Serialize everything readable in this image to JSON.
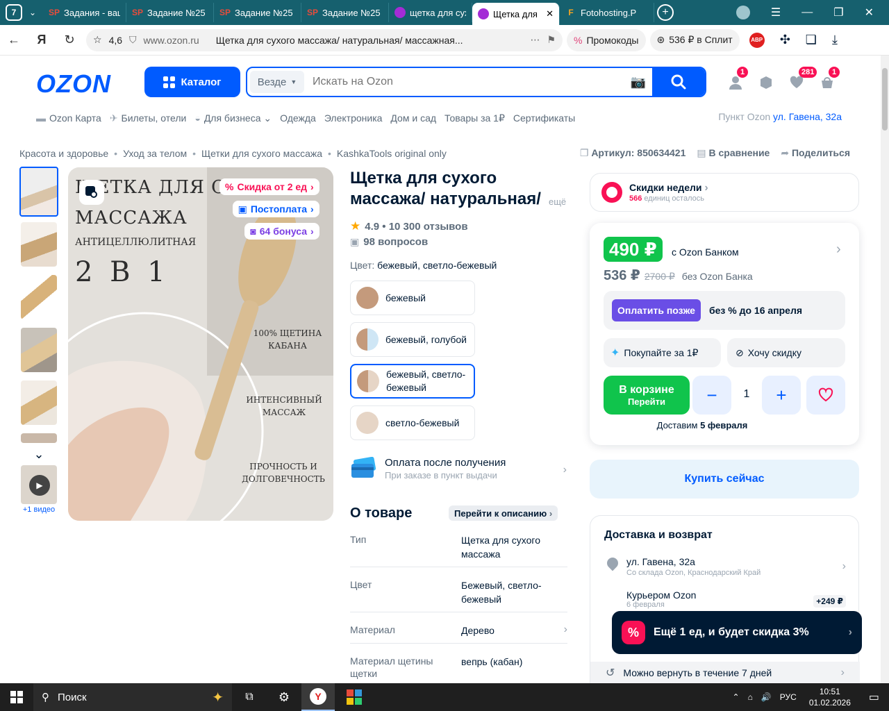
{
  "browser": {
    "tab_count": "7",
    "tabs": [
      {
        "label": "Задания - ваш",
        "icon": "SP",
        "color": "#e74c3c"
      },
      {
        "label": "Задание №25",
        "icon": "SP",
        "color": "#e74c3c"
      },
      {
        "label": "Задание №25",
        "icon": "SP",
        "color": "#e74c3c"
      },
      {
        "label": "Задание №25",
        "icon": "SP",
        "color": "#e74c3c"
      },
      {
        "label": "щетка для сух",
        "icon": "ozon",
        "color": "#a42cd6"
      },
      {
        "label": "Щетка для",
        "icon": "ozon",
        "color": "#a42cd6"
      },
      {
        "label": "Fotohosting.P",
        "icon": "F",
        "color": "#f5a623"
      }
    ],
    "site_rating": "4,6",
    "domain": "www.ozon.ru",
    "page_title": "Щетка для сухого массажа/ натуральная/ массажная...",
    "promo_pill": "Промокоды",
    "split_pill": "536 ₽ в Сплит",
    "abp": "ABP"
  },
  "header": {
    "logo": "OZON",
    "catalog": "Каталог",
    "search_scope": "Везде",
    "search_placeholder": "Искать на Ozon",
    "badges": {
      "profile": "1",
      "favorites": "281",
      "cart": "1"
    }
  },
  "topnav": [
    "Ozon Карта",
    "Билеты, отели",
    "Для бизнеса",
    "Одежда",
    "Электроника",
    "Дом и сад",
    "Товары за 1₽",
    "Сертификаты"
  ],
  "pickup": {
    "label": "Пункт Ozon",
    "address": "ул. Гавена, 32а"
  },
  "breadcrumbs": [
    "Красота и здоровье",
    "Уход за телом",
    "Щетки для сухого массажа",
    "KashkaTools original only"
  ],
  "meta": {
    "article": "Артикул: 850634421",
    "compare": "В сравнение",
    "share": "Поделиться"
  },
  "gallery": {
    "video_label": "+1 видео",
    "overlay_badges": [
      "Скидка от 2 ед",
      "Постоплата",
      "64 бонуса"
    ],
    "image_texts": {
      "title1": "ЩЕТКА ДЛЯ СУХОГО",
      "title2": "МАССАЖА",
      "subtitle": "АНТИЦЕЛЛЮЛИТНАЯ",
      "big": "2 В 1",
      "f1a": "100% ЩЕТИНА",
      "f1b": "КАБАНА",
      "f2a": "ИНТЕНСИВНЫЙ",
      "f2b": "МАССАЖ",
      "f3a": "ПРОЧНОСТЬ И",
      "f3b": "ДОЛГОВЕЧНОСТЬ"
    }
  },
  "product": {
    "title": "Щетка для сухого массажа/ натуральная/ массажная",
    "more": "ещё",
    "rating": "4.9 • 10 300 отзывов",
    "questions": "98 вопросов",
    "color_label": "Цвет:",
    "color_value": "бежевый, светло-бежевый",
    "colors": [
      {
        "label": "бежевый",
        "c1": "#c49a7c",
        "c2": "#c49a7c"
      },
      {
        "label": "бежевый, голубой",
        "c1": "#c49a7c",
        "c2": "#cfe6f5"
      },
      {
        "label": "бежевый, светло-бежевый",
        "c1": "#c49a7c",
        "c2": "#e6d5c6"
      },
      {
        "label": "светло-бежевый",
        "c1": "#e6d5c6",
        "c2": "#e6d5c6"
      }
    ],
    "pay_after_title": "Оплата после получения",
    "pay_after_sub": "При заказе в пункт выдачи",
    "about_title": "О товаре",
    "to_description": "Перейти к описанию",
    "specs": [
      {
        "k": "Тип",
        "v": "Щетка для сухого массажа"
      },
      {
        "k": "Цвет",
        "v": "Бежевый, светло-бежевый"
      },
      {
        "k": "Материал",
        "v": "Дерево"
      },
      {
        "k": "Материал щетины щетки",
        "v": "вепрь (кабан)"
      }
    ]
  },
  "offer": {
    "week_title": "Скидки недели",
    "week_count": "566",
    "week_sub": "единиц осталось",
    "price_bank": "490 ₽",
    "with_bank": "с Ozon Банком",
    "price": "536 ₽",
    "old_price": "2700 ₽",
    "without_bank": "без Ozon Банка",
    "pay_later_btn": "Оплатить позже",
    "pay_later_text": "без % до 16 апреля",
    "buy_for_1": "Покупайте за 1₽",
    "want_discount": "Хочу скидку",
    "cart_title": "В корзине",
    "cart_sub": "Перейти",
    "qty": "1",
    "delivery_note_pre": "Доставим",
    "delivery_note_date": "5 февраля",
    "buy_now": "Купить сейчас"
  },
  "delivery": {
    "title": "Доставка и возврат",
    "address": "ул. Гавена, 32а",
    "address_sub": "Со склада Ozon, Краснодарский Край",
    "courier": "Курьером Ozon",
    "courier_date": "6 февраля",
    "courier_price": "+249 ₽",
    "return": "Можно вернуть в течение 7 дней"
  },
  "toast": {
    "text": "Ещё 1 ед, и будет скидка 3%"
  },
  "taskbar": {
    "search": "Поиск",
    "lang": "РУС",
    "time": "10:51",
    "date": "01.02.2026"
  }
}
